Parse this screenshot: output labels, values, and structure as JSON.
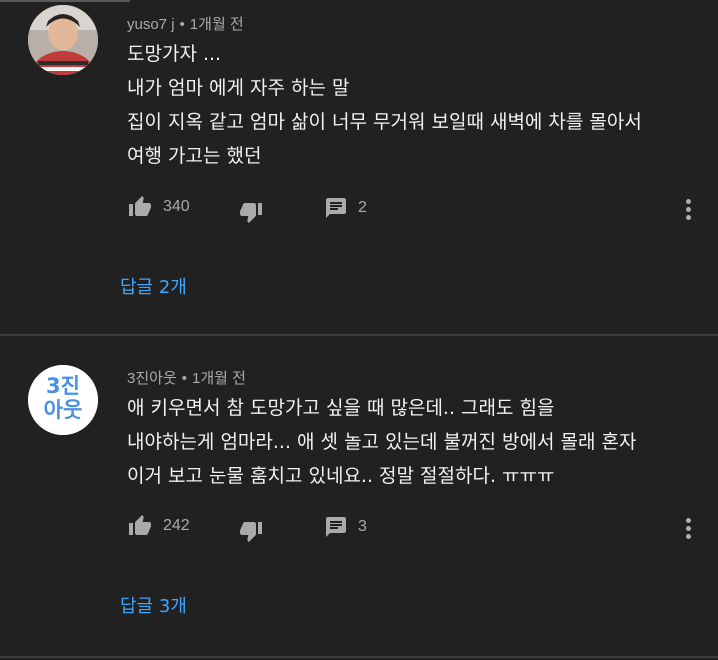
{
  "comments": [
    {
      "author": "yuso7 j",
      "separator": "•",
      "time": "1개월 전",
      "text": "도망가자 ...\n내가 엄마 에게 자주 하는 말\n집이 지옥 같고 엄마 삶이 너무 무거워 보일때 새벽에 차를 몰아서\n여행 가고는 했던",
      "likes": "340",
      "reply_count": "2",
      "replies_label": "답글 2개",
      "avatar_icon": "user-photo"
    },
    {
      "author": "3진아웃",
      "separator": "•",
      "time": "1개월 전",
      "text": "애 키우면서 참 도망가고 싶을 때 많은데.. 그래도 힘을\n내야하는게 엄마라...   애 셋 놀고 있는데 불꺼진 방에서 몰래 혼자\n이거 보고 눈물 훔치고 있네요.. 정말 절절하다. ㅠㅠㅠ",
      "likes": "242",
      "reply_count": "3",
      "replies_label": "답글 3개",
      "avatar_text": "3진아웃",
      "avatar_line1": "3진",
      "avatar_line2": "아웃"
    }
  ],
  "colors": {
    "background": "#212121",
    "text": "#f1f1f1",
    "secondary": "#aaaaaa",
    "link": "#3ea6ff"
  },
  "icons": [
    "thumb-up-icon",
    "thumb-down-icon",
    "reply-icon",
    "more-vert-icon"
  ]
}
